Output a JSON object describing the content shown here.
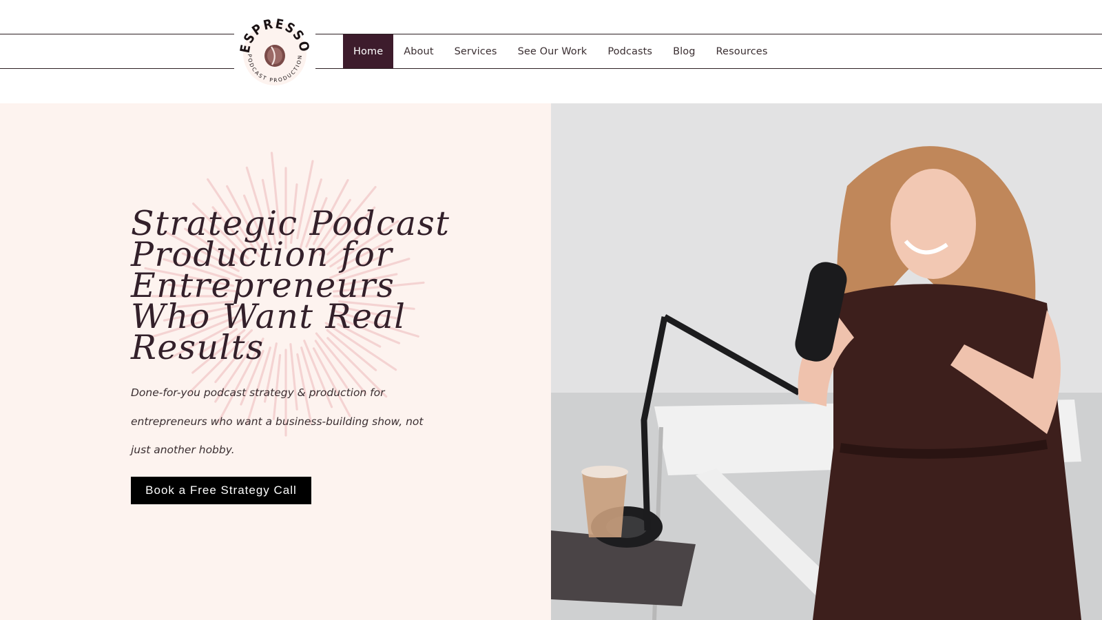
{
  "brand": {
    "logo_top": "ESPRESSO",
    "logo_bottom": "PODCAST PRODUCTION"
  },
  "nav": {
    "items": [
      {
        "label": "Home",
        "active": true
      },
      {
        "label": "About",
        "active": false
      },
      {
        "label": "Services",
        "active": false
      },
      {
        "label": "See Our Work",
        "active": false
      },
      {
        "label": "Podcasts",
        "active": false
      },
      {
        "label": "Blog",
        "active": false
      },
      {
        "label": "Resources",
        "active": false
      }
    ]
  },
  "hero": {
    "headline_lines": [
      "Strategic Podcast",
      "Production for",
      "Entrepreneurs",
      "Who Want Real",
      "Results"
    ],
    "subtext_lines": [
      "Done-for-you podcast strategy & production for",
      "entrepreneurs who want a business-building show, not",
      "just another hobby."
    ],
    "cta_label": "Book a Free Strategy Call"
  },
  "colors": {
    "accent": "#3d1c2c",
    "hero_bg": "#fdf3ef",
    "burst": "#f2c9c9",
    "headline": "#33202a",
    "button": "#000000"
  }
}
